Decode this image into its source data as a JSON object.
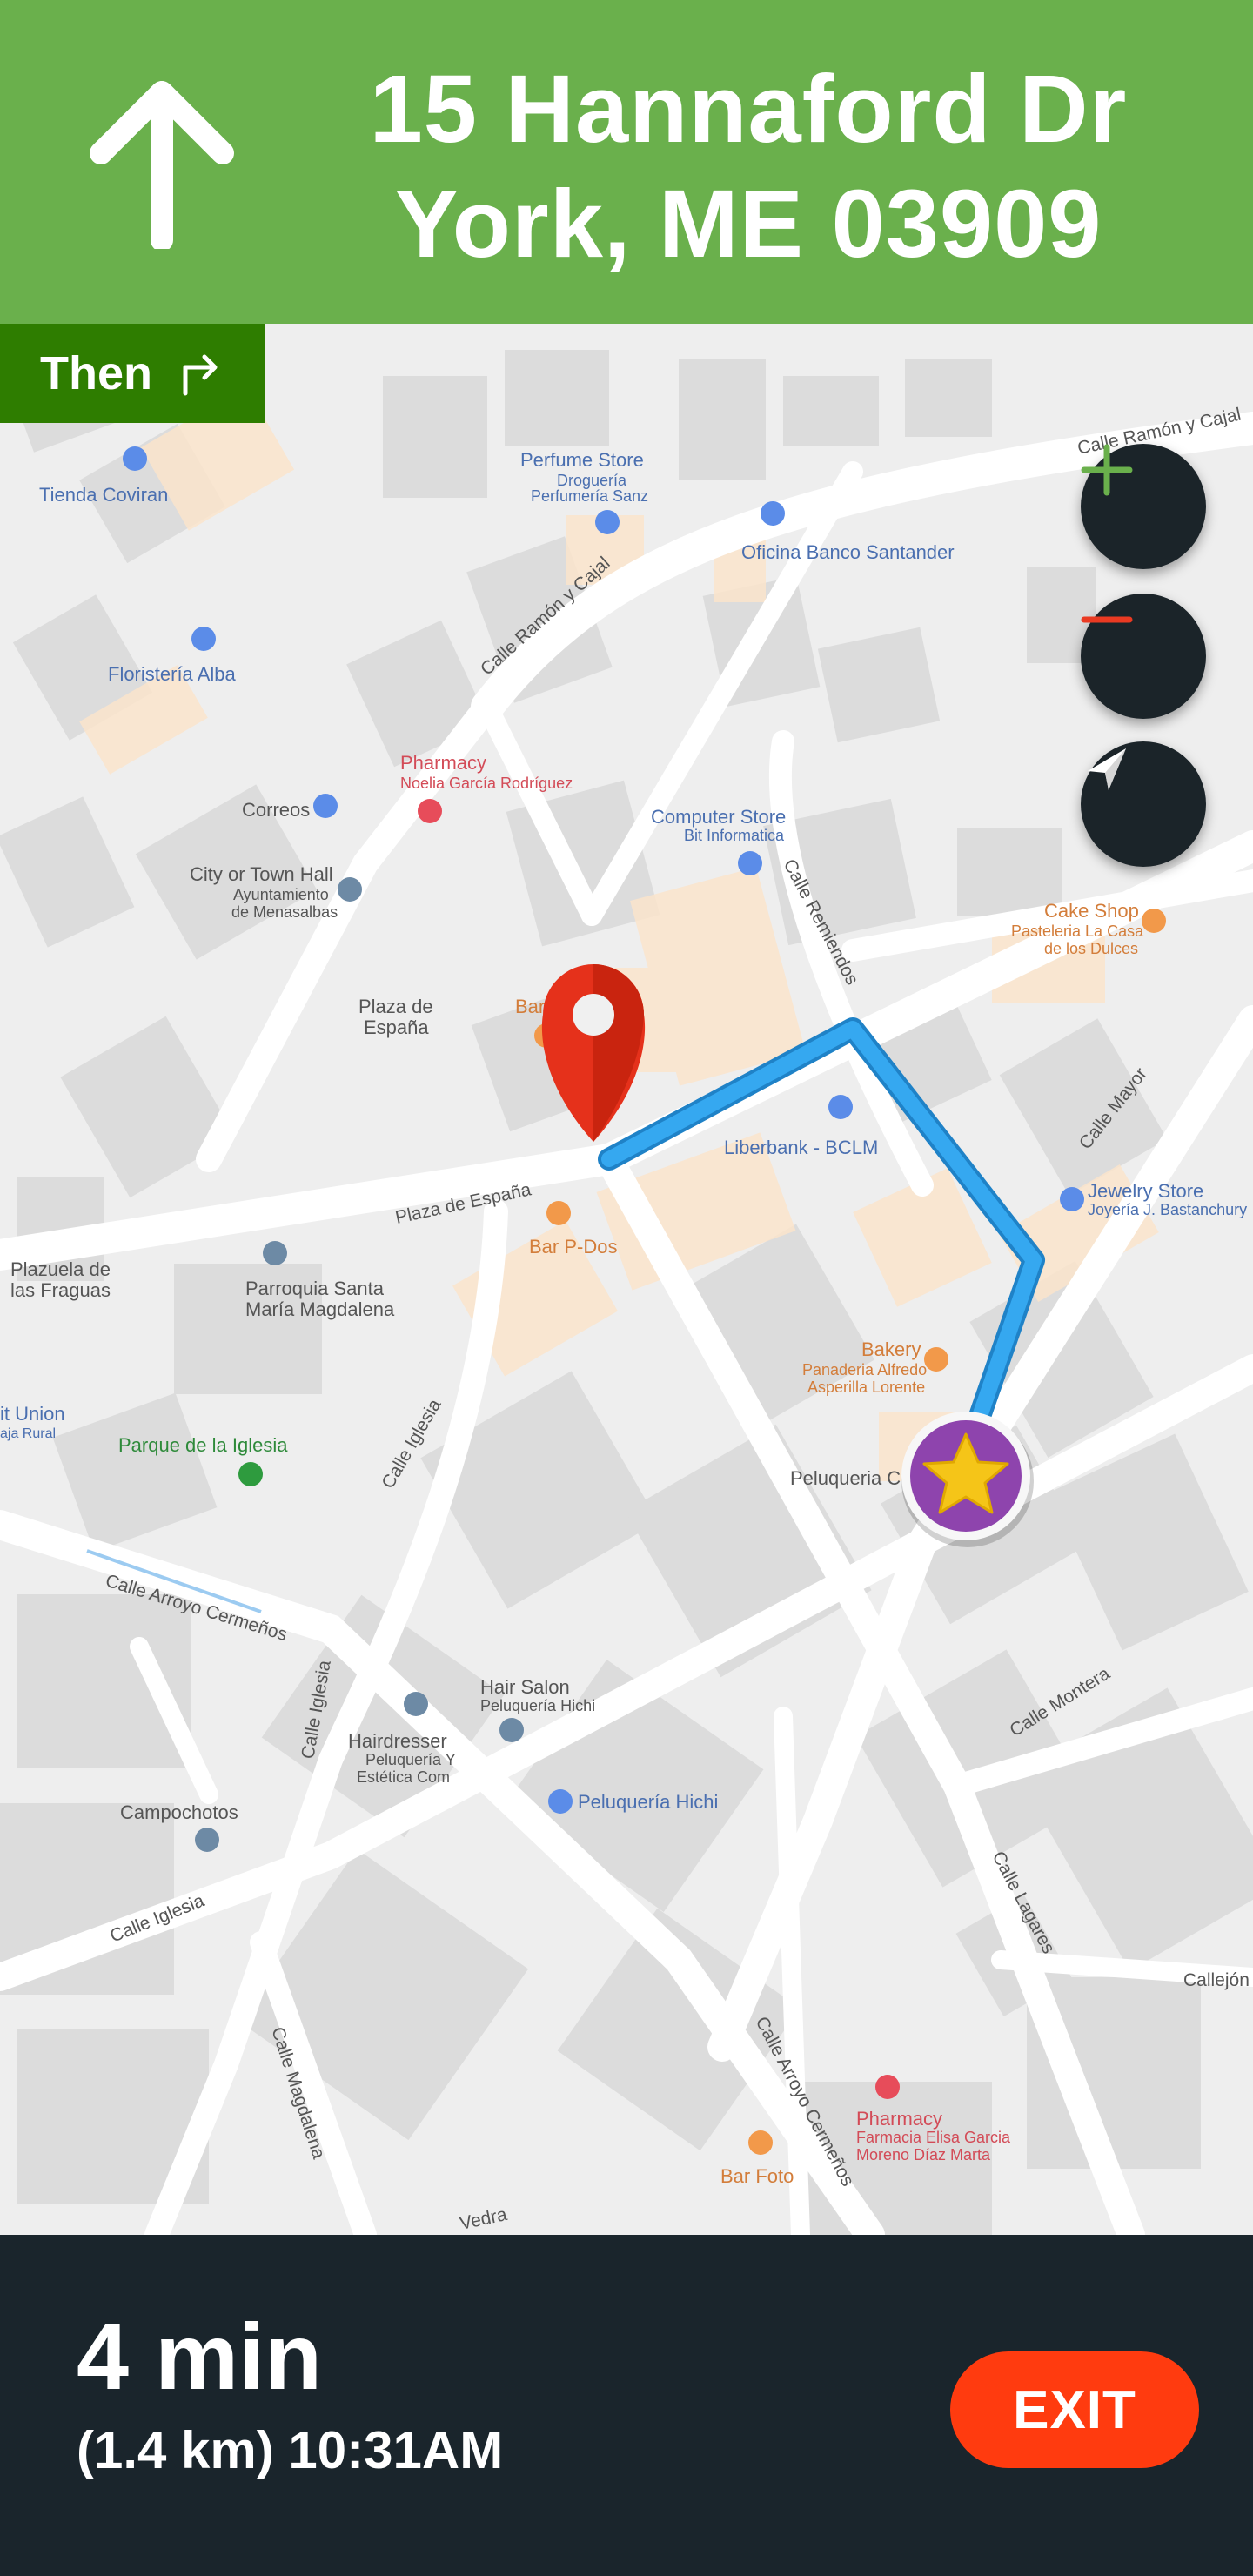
{
  "header": {
    "line1": "15 Hannaford Dr",
    "line2": "York, ME 03909",
    "direction_icon": "arrow-up-icon",
    "color": "#6ab04c"
  },
  "then": {
    "label": "Then",
    "icon": "turn-right-icon"
  },
  "controls": {
    "zoom_in_icon": "plus-icon",
    "zoom_out_icon": "minus-icon",
    "compass_icon": "compass-icon"
  },
  "map": {
    "streets": [
      "Calle Ramón y Cajal",
      "Calle Remiendos",
      "Calle Mayor",
      "Plaza de España",
      "Calle Iglesia",
      "Calle Arroyo Cermeños",
      "Calle Montera",
      "Calle Lagares",
      "Callejón",
      "Calle Magdalena",
      "Vedra"
    ],
    "places": {
      "tienda": "Tienda Coviran",
      "perfume": "Perfume Store",
      "perfume_sub1": "Droguería",
      "perfume_sub2": "Perfumería Sanz",
      "banco": "Oficina Banco Santander",
      "floristeria": "Floristería Alba",
      "pharmacy1": "Pharmacy",
      "pharmacy1_sub": "Noelia García Rodríguez",
      "correos": "Correos",
      "computer": "Computer Store",
      "computer_sub": "Bit Informatica",
      "city1": "City or Town Hall",
      "city2": "Ayuntamiento",
      "city3": "de Menasalbas",
      "cake": "Cake Shop",
      "cake_sub1": "Pasteleria La Casa",
      "cake_sub2": "de los Dulces",
      "plaza1": "Plaza de",
      "plaza2": "España",
      "barjake": "Bar Jake",
      "liberbank": "Liberbank - BCLM",
      "jewelry": "Jewelry Store",
      "jewelry_sub": "Joyería J. Bastanchury",
      "barpdos": "Bar P-Dos",
      "plazuela1": "Plazuela de",
      "plazuela2": "las Fraguas",
      "parroquia1": "Parroquia Santa",
      "parroquia2": "María Magdalena",
      "bakery": "Bakery",
      "bakery_sub1": "Panaderia Alfredo",
      "bakery_sub2": "Asperilla Lorente",
      "union1": "it Union",
      "union2": "aja Rural",
      "parque": "Parque de la Iglesia",
      "peluqueria_c": "Peluqueria C",
      "hairsalon": "Hair Salon",
      "hairsalon_sub": "Peluquería Hichi",
      "hairdresser": "Hairdresser",
      "hairdresser_sub1": "Peluquería Y",
      "hairdresser_sub2": "Estética Com",
      "peluqueria_hichi": "Peluquería Hichi",
      "campochotos": "Campochotos",
      "pharmacy2": "Pharmacy",
      "pharmacy2_sub1": "Farmacia Elisa Garcia",
      "pharmacy2_sub2": "Moreno Díaz Marta",
      "barfoto": "Bar Foto"
    },
    "route_color": "#35a8f0",
    "destination_icon": "map-pin-icon",
    "current_location_icon": "star-icon"
  },
  "footer": {
    "eta": "4 min",
    "detail": "(1.4 km) 10:31AM",
    "exit_label": "EXIT",
    "exit_color": "#ff3b0f"
  }
}
